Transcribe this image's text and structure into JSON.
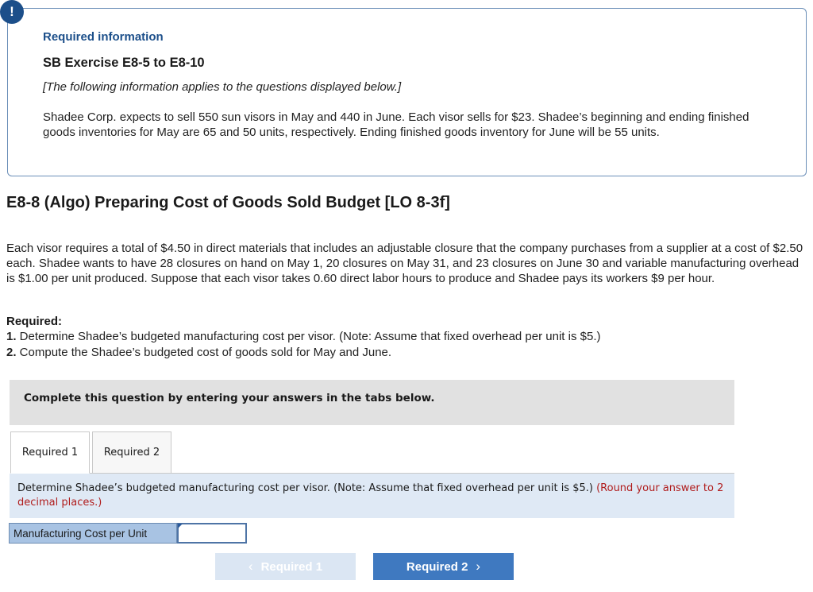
{
  "alert": {
    "symbol": "!"
  },
  "info": {
    "title": "Required information",
    "subtitle": "SB Exercise E8-5 to E8-10",
    "note": "[The following information applies to the questions displayed below.]",
    "body": "Shadee Corp. expects to sell 550 sun visors in May and 440 in June. Each visor sells for $23. Shadee’s beginning and ending finished goods inventories for May are 65 and 50 units, respectively. Ending finished goods inventory for June will be 55 units."
  },
  "exercise": {
    "title": "E8-8 (Algo) Preparing Cost of Goods Sold Budget [LO 8-3f]",
    "body": "Each visor requires a total of $4.50 in direct materials that includes an adjustable closure that the company purchases from a supplier at a cost of $2.50 each. Shadee wants to have 28 closures on hand on May 1, 20 closures on May 31, and 23 closures on June 30 and variable manufacturing overhead is $1.00 per unit produced. Suppose that each visor takes 0.60 direct labor hours to produce and Shadee pays its workers $9 per hour.",
    "required_heading": "Required:",
    "requirements": [
      {
        "num": "1.",
        "text": " Determine Shadee’s budgeted manufacturing cost per visor. (Note: Assume that fixed overhead per unit is $5.)"
      },
      {
        "num": "2.",
        "text": " Compute the Shadee’s budgeted cost of goods sold for May and June."
      }
    ]
  },
  "complete_text": "Complete this question by entering your answers in the tabs below.",
  "tabs": [
    {
      "label": "Required 1"
    },
    {
      "label": "Required 2"
    }
  ],
  "prompt": {
    "text": "Determine Shadee’s budgeted manufacturing cost per visor. (Note: Assume that fixed overhead per unit is $5.) ",
    "hint": "(Round your answer to 2 decimal places.)"
  },
  "answer": {
    "label": "Manufacturing Cost per Unit",
    "value": ""
  },
  "nav": {
    "prev_label": "Required 1",
    "next_label": "Required 2",
    "prev_icon": "‹",
    "next_icon": "›"
  },
  "colors": {
    "accent": "#1c4f8a",
    "next_button": "#3f79c0",
    "prev_button_disabled": "#dbe6f3",
    "hint_red": "#b01c1c",
    "prompt_bg": "#dfe9f5"
  }
}
